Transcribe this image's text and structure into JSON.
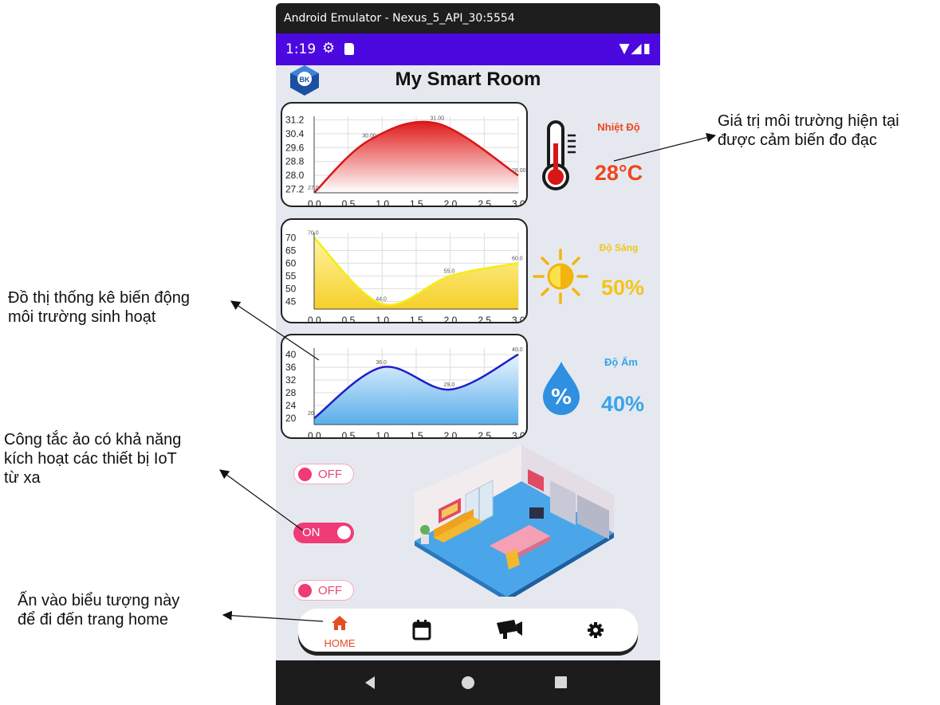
{
  "annotations": {
    "right_top": [
      "Giá trị môi trường hiện tại",
      "được cảm biến đo đạc"
    ],
    "left_chart": [
      "Đồ thị thống kê biến động",
      "môi trường sinh hoạt"
    ],
    "left_switch": [
      "Công tắc ảo có khả năng",
      "kích hoạt các thiết bị IoT",
      "từ xa"
    ],
    "left_home": [
      "Ấn vào biểu tượng này",
      "để đi đến trang home"
    ]
  },
  "window": {
    "title": "Android Emulator - Nexus_5_API_30:5554"
  },
  "statusbar": {
    "time": "1:19"
  },
  "app": {
    "title": "My Smart Room",
    "logo_text": "BK"
  },
  "sensors": [
    {
      "label": "Nhiệt Độ",
      "value": "28°C",
      "color": "#f0451c",
      "icon": "thermometer-icon"
    },
    {
      "label": "Độ Sáng",
      "value": "50%",
      "color": "#f4c418",
      "icon": "sun-icon"
    },
    {
      "label": "Độ Ẩm",
      "value": "40%",
      "color": "#3aa3ea",
      "icon": "humidity-drop-icon"
    }
  ],
  "chart_data": [
    {
      "type": "area",
      "x": [
        0.0,
        0.8,
        1.8,
        3.0
      ],
      "values": [
        27.0,
        30.0,
        31.0,
        28.0
      ],
      "point_labels": [
        "27.0",
        "30.00",
        "31.00",
        "28.00"
      ],
      "y_ticks": [
        "31.2",
        "30.4",
        "29.6",
        "28.8",
        "28.0",
        "27.2"
      ],
      "x_ticks": [
        "0.0",
        "0.5",
        "1.0",
        "1.5",
        "2.0",
        "2.5",
        "3.0"
      ],
      "ylim": [
        27.0,
        31.4
      ],
      "xlim": [
        0,
        3
      ],
      "line_color": "#d81616",
      "fill_top": "#e01b1b",
      "fill_bottom": "#ffffff",
      "grid": true
    },
    {
      "type": "area",
      "x": [
        0.0,
        1.0,
        2.0,
        3.0
      ],
      "values": [
        70.0,
        44.0,
        55.0,
        60.0
      ],
      "point_labels": [
        "70.0",
        "44.0",
        "55.0",
        "60.0"
      ],
      "y_ticks": [
        "70",
        "65",
        "60",
        "55",
        "50",
        "45"
      ],
      "x_ticks": [
        "0.0",
        "0.5",
        "1.0",
        "1.5",
        "2.0",
        "2.5",
        "3.0"
      ],
      "ylim": [
        42,
        72
      ],
      "xlim": [
        0,
        3
      ],
      "line_color": "#f2ee16",
      "fill_top": "#fff4a0",
      "fill_bottom": "#f5cf2a",
      "grid": true
    },
    {
      "type": "area",
      "x": [
        0.0,
        1.0,
        2.0,
        3.0
      ],
      "values": [
        20.0,
        36.0,
        29.0,
        40.0
      ],
      "point_labels": [
        "20",
        "36.0",
        "29.0",
        "40.0"
      ],
      "y_ticks": [
        "40",
        "36",
        "32",
        "28",
        "24",
        "20"
      ],
      "x_ticks": [
        "0.0",
        "0.5",
        "1.0",
        "1.5",
        "2.0",
        "2.5",
        "3.0"
      ],
      "ylim": [
        18,
        42
      ],
      "xlim": [
        0,
        3
      ],
      "line_color": "#1f20c8",
      "fill_top": "#e8f4ff",
      "fill_bottom": "#5aaeea",
      "grid": true
    }
  ],
  "switches": [
    {
      "label": "OFF",
      "state": "off"
    },
    {
      "label": "ON",
      "state": "on"
    },
    {
      "label": "OFF",
      "state": "off"
    }
  ],
  "nav": {
    "items": [
      {
        "label": "HOME",
        "icon": "home-icon",
        "active": true
      },
      {
        "label": "",
        "icon": "calendar-icon",
        "active": false
      },
      {
        "label": "",
        "icon": "camera-icon",
        "active": false
      },
      {
        "label": "",
        "icon": "gear-icon",
        "active": false
      }
    ]
  },
  "colors": {
    "status_bar": "#4b09e0",
    "accent": "#e54c22",
    "switch": "#ef3b76"
  }
}
